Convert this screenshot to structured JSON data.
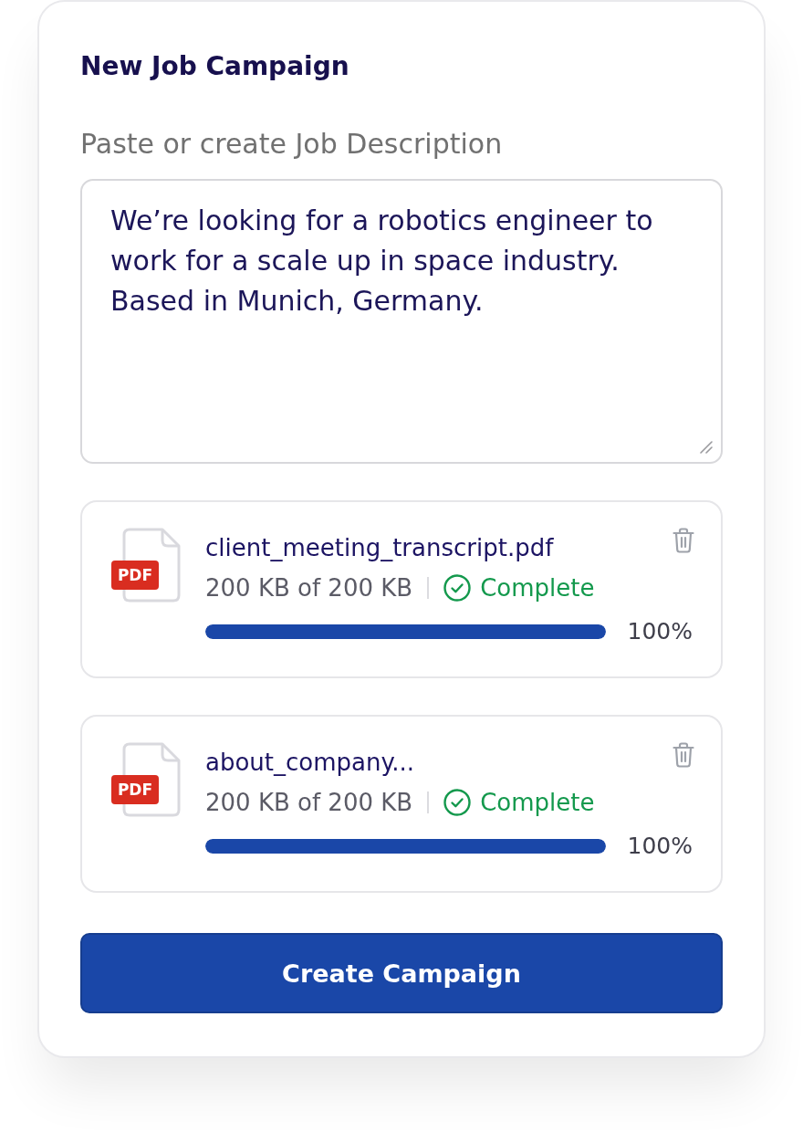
{
  "title": "New Job Campaign",
  "description": {
    "label": "Paste or create Job Description",
    "value": "We’re looking for a robotics engineer to work for a scale up in space industry. Based in Munich, Germany."
  },
  "files": [
    {
      "badge": "PDF",
      "name": "client_meeting_transcript.pdf",
      "size": "200 KB of 200 KB",
      "status": "Complete",
      "complete": true,
      "level": 1,
      "percent": "100%"
    },
    {
      "badge": "PDF",
      "name": "about_company...",
      "size": "200 KB of 200 KB",
      "status": "Complete",
      "complete": true,
      "level": 1,
      "percent": "100%"
    }
  ],
  "submit_button": "Create Campaign"
}
